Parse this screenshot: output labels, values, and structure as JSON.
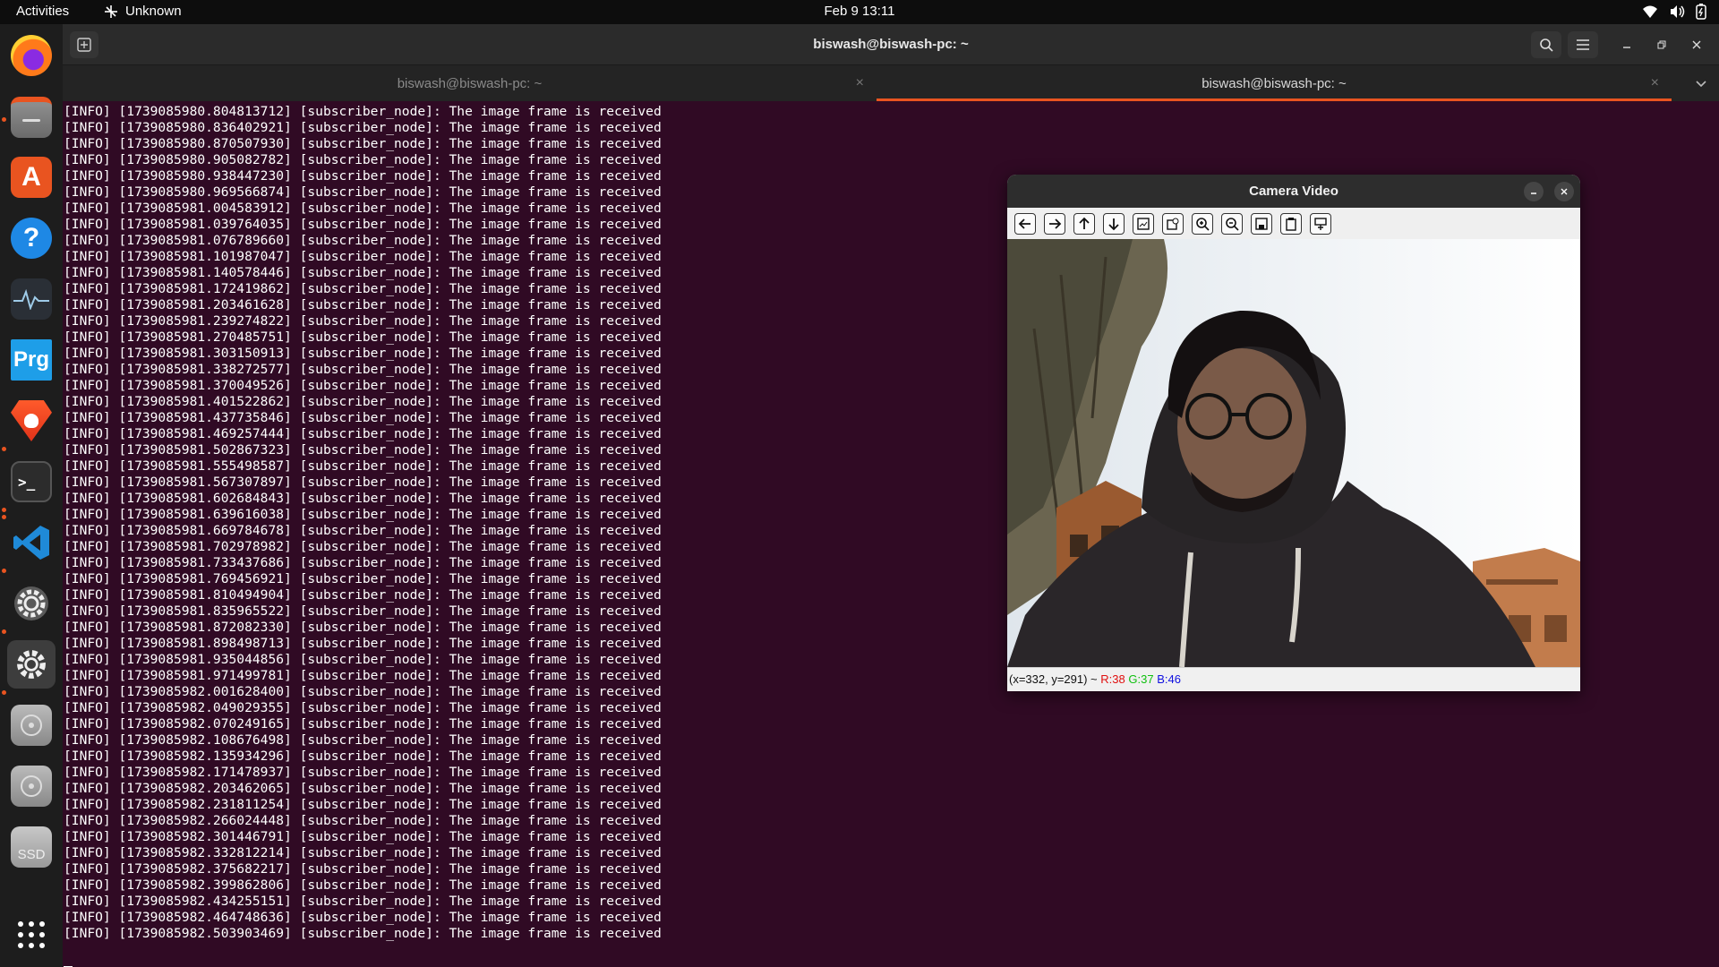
{
  "topbar": {
    "activities": "Activities",
    "app_name": "Unknown",
    "clock": "Feb 9  13:11"
  },
  "dock": {
    "items": [
      {
        "name": "firefox",
        "icon": "firefox-icon"
      },
      {
        "name": "files",
        "icon": "folder-icon"
      },
      {
        "name": "app-center",
        "icon": "store-icon"
      },
      {
        "name": "help",
        "icon": "help-icon",
        "label": "?"
      },
      {
        "name": "system-monitor",
        "icon": "pulse-icon"
      },
      {
        "name": "prg",
        "icon": "prg-icon",
        "label": "Prg"
      },
      {
        "name": "brave",
        "icon": "brave-icon"
      },
      {
        "name": "terminal",
        "icon": "terminal-icon",
        "label": ">_"
      },
      {
        "name": "vscode",
        "icon": "vscode-icon"
      },
      {
        "name": "settings-gear",
        "icon": "gear-icon"
      },
      {
        "name": "settings-active",
        "icon": "gear-icon"
      },
      {
        "name": "drive-1",
        "icon": "disk-icon"
      },
      {
        "name": "drive-2",
        "icon": "disk-icon"
      },
      {
        "name": "ssd",
        "icon": "ssd-icon",
        "label": "SSD"
      },
      {
        "name": "show-apps",
        "icon": "grid-icon"
      }
    ]
  },
  "terminal": {
    "window_title": "biswash@biswash-pc: ~",
    "tabs": [
      {
        "label": "biswash@biswash-pc: ~",
        "active": false
      },
      {
        "label": "biswash@biswash-pc: ~",
        "active": true
      }
    ],
    "log_lines": [
      "[INFO] [1739085980.804813712] [subscriber_node]: The image frame is received",
      "[INFO] [1739085980.836402921] [subscriber_node]: The image frame is received",
      "[INFO] [1739085980.870507930] [subscriber_node]: The image frame is received",
      "[INFO] [1739085980.905082782] [subscriber_node]: The image frame is received",
      "[INFO] [1739085980.938447230] [subscriber_node]: The image frame is received",
      "[INFO] [1739085980.969566874] [subscriber_node]: The image frame is received",
      "[INFO] [1739085981.004583912] [subscriber_node]: The image frame is received",
      "[INFO] [1739085981.039764035] [subscriber_node]: The image frame is received",
      "[INFO] [1739085981.076789660] [subscriber_node]: The image frame is received",
      "[INFO] [1739085981.101987047] [subscriber_node]: The image frame is received",
      "[INFO] [1739085981.140578446] [subscriber_node]: The image frame is received",
      "[INFO] [1739085981.172419862] [subscriber_node]: The image frame is received",
      "[INFO] [1739085981.203461628] [subscriber_node]: The image frame is received",
      "[INFO] [1739085981.239274822] [subscriber_node]: The image frame is received",
      "[INFO] [1739085981.270485751] [subscriber_node]: The image frame is received",
      "[INFO] [1739085981.303150913] [subscriber_node]: The image frame is received",
      "[INFO] [1739085981.338272577] [subscriber_node]: The image frame is received",
      "[INFO] [1739085981.370049526] [subscriber_node]: The image frame is received",
      "[INFO] [1739085981.401522862] [subscriber_node]: The image frame is received",
      "[INFO] [1739085981.437735846] [subscriber_node]: The image frame is received",
      "[INFO] [1739085981.469257444] [subscriber_node]: The image frame is received",
      "[INFO] [1739085981.502867323] [subscriber_node]: The image frame is received",
      "[INFO] [1739085981.555498587] [subscriber_node]: The image frame is received",
      "[INFO] [1739085981.567307897] [subscriber_node]: The image frame is received",
      "[INFO] [1739085981.602684843] [subscriber_node]: The image frame is received",
      "[INFO] [1739085981.639616038] [subscriber_node]: The image frame is received",
      "[INFO] [1739085981.669784678] [subscriber_node]: The image frame is received",
      "[INFO] [1739085981.702978982] [subscriber_node]: The image frame is received",
      "[INFO] [1739085981.733437686] [subscriber_node]: The image frame is received",
      "[INFO] [1739085981.769456921] [subscriber_node]: The image frame is received",
      "[INFO] [1739085981.810494904] [subscriber_node]: The image frame is received",
      "[INFO] [1739085981.835965522] [subscriber_node]: The image frame is received",
      "[INFO] [1739085981.872082330] [subscriber_node]: The image frame is received",
      "[INFO] [1739085981.898498713] [subscriber_node]: The image frame is received",
      "[INFO] [1739085981.935044856] [subscriber_node]: The image frame is received",
      "[INFO] [1739085981.971499781] [subscriber_node]: The image frame is received",
      "[INFO] [1739085982.001628400] [subscriber_node]: The image frame is received",
      "[INFO] [1739085982.049029355] [subscriber_node]: The image frame is received",
      "[INFO] [1739085982.070249165] [subscriber_node]: The image frame is received",
      "[INFO] [1739085982.108676498] [subscriber_node]: The image frame is received",
      "[INFO] [1739085982.135934296] [subscriber_node]: The image frame is received",
      "[INFO] [1739085982.171478937] [subscriber_node]: The image frame is received",
      "[INFO] [1739085982.203462065] [subscriber_node]: The image frame is received",
      "[INFO] [1739085982.231811254] [subscriber_node]: The image frame is received",
      "[INFO] [1739085982.266024448] [subscriber_node]: The image frame is received",
      "[INFO] [1739085982.301446791] [subscriber_node]: The image frame is received",
      "[INFO] [1739085982.332812214] [subscriber_node]: The image frame is received",
      "[INFO] [1739085982.375682217] [subscriber_node]: The image frame is received",
      "[INFO] [1739085982.399862806] [subscriber_node]: The image frame is received",
      "[INFO] [1739085982.434255151] [subscriber_node]: The image frame is received",
      "[INFO] [1739085982.464748636] [subscriber_node]: The image frame is received",
      "[INFO] [1739085982.503903469] [subscriber_node]: The image frame is received"
    ]
  },
  "camera_window": {
    "title": "Camera Video",
    "toolbar": [
      "pan-left-icon",
      "pan-right-icon",
      "pan-up-icon",
      "pan-down-icon",
      "zoom-fit-icon",
      "zoom-original-icon",
      "zoom-in-icon",
      "zoom-out-icon",
      "save-icon",
      "copy-icon",
      "properties-icon"
    ],
    "status": {
      "coords": "(x=332, y=291) ~",
      "r": "R:38",
      "g": "G:37",
      "b": "B:46"
    }
  },
  "colors": {
    "terminal_bg": "#300a24",
    "accent": "#e95420",
    "headerbar": "#2b2b2b",
    "dock": "#1d1d1d"
  }
}
